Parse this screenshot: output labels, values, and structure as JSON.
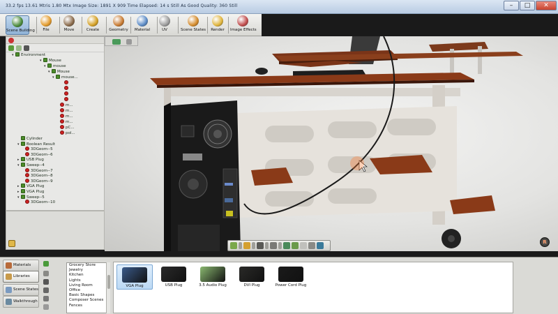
{
  "titlebar": {
    "stats": "33.2 fps    13.61 Mtris    1.80 Mtx    Image Size: 1891 X 909    Time Elapsed: 14 s    Still As Good Quality: 360 Still",
    "minimize": "–",
    "maximize": "□",
    "close": "✕"
  },
  "toolbar": {
    "items": [
      {
        "label": "Scene Building",
        "icon": "scene-building-icon",
        "color": "#4a8a3a"
      },
      {
        "label": "File",
        "icon": "file-icon",
        "color": "#e39a2a"
      },
      {
        "label": "Move",
        "icon": "move-icon",
        "color": "#8a6a4a"
      },
      {
        "label": "Create",
        "icon": "create-icon",
        "color": "#d4a024"
      },
      {
        "label": "Geometry",
        "icon": "geometry-icon",
        "color": "#c87a30"
      },
      {
        "label": "Material",
        "icon": "material-icon",
        "color": "#5a8ac6"
      },
      {
        "label": "UV",
        "icon": "uv-icon",
        "color": "#9a9a9a"
      },
      {
        "label": "Scene States",
        "icon": "scene-states-icon",
        "color": "#d48a2a"
      },
      {
        "label": "Render",
        "icon": "render-icon",
        "color": "#e0b43a"
      },
      {
        "label": "Image Effects",
        "icon": "image-effects-icon",
        "color": "#c04a4a"
      }
    ]
  },
  "scene_tree": {
    "rows": [
      {
        "label": "Environment",
        "icon": "green",
        "depth": 0,
        "twisty": "▾"
      },
      {
        "label": "Mouse",
        "icon": "green",
        "depth": 4,
        "twisty": "▾"
      },
      {
        "label": "mouse",
        "icon": "green",
        "depth": 5,
        "twisty": "▾"
      },
      {
        "label": "Mouse",
        "icon": "green",
        "depth": 6,
        "twisty": "▾"
      },
      {
        "label": "mouse...",
        "icon": "green",
        "depth": 7,
        "twisty": "▾"
      },
      {
        "label": "",
        "icon": "red",
        "depth": 9,
        "twisty": ""
      },
      {
        "label": "",
        "icon": "red",
        "depth": 9,
        "twisty": ""
      },
      {
        "label": "",
        "icon": "red",
        "depth": 9,
        "twisty": ""
      },
      {
        "label": "",
        "icon": "red",
        "depth": 9,
        "twisty": ""
      },
      {
        "label": "m...",
        "icon": "red",
        "depth": 8,
        "twisty": ""
      },
      {
        "label": "m...",
        "icon": "red",
        "depth": 8,
        "twisty": ""
      },
      {
        "label": "m...",
        "icon": "red",
        "depth": 8,
        "twisty": ""
      },
      {
        "label": "m...",
        "icon": "red",
        "depth": 8,
        "twisty": ""
      },
      {
        "label": "pC...",
        "icon": "red",
        "depth": 8,
        "twisty": ""
      },
      {
        "label": "pol...",
        "icon": "red",
        "depth": 8,
        "twisty": ""
      },
      {
        "label": "Cylinder",
        "icon": "green",
        "depth": 1,
        "twisty": ""
      },
      {
        "label": "Boolean Result",
        "icon": "green",
        "depth": 1,
        "twisty": "▾"
      },
      {
        "label": "3DGeom--5",
        "icon": "red",
        "depth": 2,
        "twisty": ""
      },
      {
        "label": "3DGeom--6",
        "icon": "red",
        "depth": 2,
        "twisty": ""
      },
      {
        "label": "USB Plug",
        "icon": "green",
        "depth": 1,
        "twisty": "▸"
      },
      {
        "label": "Sweep--4",
        "icon": "green",
        "depth": 1,
        "twisty": "▾"
      },
      {
        "label": "3DGeom--7",
        "icon": "red",
        "depth": 2,
        "twisty": ""
      },
      {
        "label": "3DGeom--8",
        "icon": "red",
        "depth": 2,
        "twisty": ""
      },
      {
        "label": "3DGeom--9",
        "icon": "red",
        "depth": 2,
        "twisty": ""
      },
      {
        "label": "VGA Plug",
        "icon": "green",
        "depth": 1,
        "twisty": "▸"
      },
      {
        "label": "VGA Plug",
        "icon": "green",
        "depth": 1,
        "twisty": "▸"
      },
      {
        "label": "Sweep--5",
        "icon": "green",
        "depth": 1,
        "twisty": "▾"
      },
      {
        "label": "3DGeom--10",
        "icon": "red",
        "depth": 2,
        "twisty": ""
      }
    ]
  },
  "library": {
    "tabs": [
      {
        "label": "Materials",
        "icon": "materials-icon",
        "color": "#b86a3a"
      },
      {
        "label": "Libraries",
        "icon": "libraries-icon",
        "color": "#c89a4a",
        "active": true
      },
      {
        "label": "Scene States",
        "icon": "scene-states-tab-icon",
        "color": "#7a9ac0"
      },
      {
        "label": "Walkthrough",
        "icon": "walkthrough-icon",
        "color": "#6a8aa0"
      }
    ],
    "categories": [
      "Grocery Store",
      "Jewelry",
      "Kitchen",
      "Lights",
      "Living Room",
      "Office",
      "Basic Shapes",
      "Composer Scenes",
      "Fences"
    ],
    "items": [
      {
        "label": "VGA Plug",
        "color": "#3a5a8a",
        "selected": true
      },
      {
        "label": "USB Plug",
        "color": "#2a2a2a",
        "selected": false
      },
      {
        "label": "3.5 Audio Plug",
        "color": "#8ab870",
        "selected": false
      },
      {
        "label": "DVI Plug",
        "color": "#2a2a28",
        "selected": false
      },
      {
        "label": "Power Cord Plug",
        "color": "#1a1a1a",
        "selected": false
      }
    ]
  },
  "viewport": {
    "corner_button": "R"
  }
}
